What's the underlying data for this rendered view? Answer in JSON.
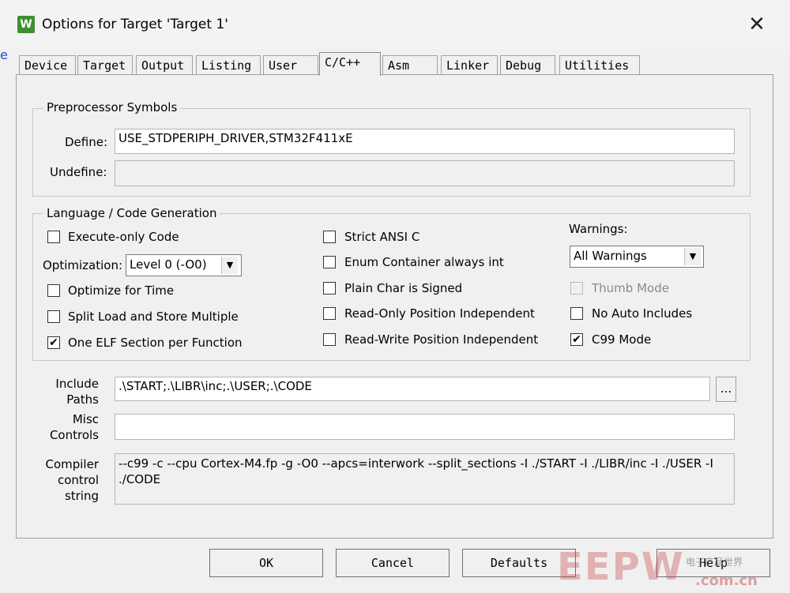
{
  "window": {
    "title": "Options for Target 'Target 1'",
    "close": "✕",
    "left_artifact": "e"
  },
  "tabs": [
    {
      "label": "Device"
    },
    {
      "label": "Target"
    },
    {
      "label": "Output"
    },
    {
      "label": "Listing"
    },
    {
      "label": "User"
    },
    {
      "label": "C/C++"
    },
    {
      "label": "Asm"
    },
    {
      "label": "Linker"
    },
    {
      "label": "Debug"
    },
    {
      "label": "Utilities"
    }
  ],
  "active_tab": "C/C++",
  "preprocessor": {
    "group_label": "Preprocessor Symbols",
    "define_label": "Define:",
    "define_value": "USE_STDPERIPH_DRIVER,STM32F411xE",
    "undefine_label": "Undefine:",
    "undefine_value": ""
  },
  "codegen": {
    "group_label": "Language / Code Generation",
    "execute_only": {
      "label": "Execute-only Code",
      "checked": false
    },
    "optimization_label": "Optimization:",
    "optimization_value": "Level 0 (-O0)",
    "optimize_time": {
      "label": "Optimize for Time",
      "checked": false
    },
    "split_load": {
      "label": "Split Load and Store Multiple",
      "checked": false
    },
    "one_elf": {
      "label": "One ELF Section per Function",
      "checked": true
    },
    "strict_ansi": {
      "label": "Strict ANSI C",
      "checked": false
    },
    "enum_container": {
      "label": "Enum Container always int",
      "checked": false
    },
    "plain_char": {
      "label": "Plain Char is Signed",
      "checked": false
    },
    "ro_pos": {
      "label": "Read-Only Position Independent",
      "checked": false
    },
    "rw_pos": {
      "label": "Read-Write Position Independent",
      "checked": false
    },
    "warnings_label": "Warnings:",
    "warnings_value": "All Warnings",
    "thumb_mode": {
      "label": "Thumb Mode",
      "checked": false
    },
    "no_auto_includes": {
      "label": "No Auto Includes",
      "checked": false
    },
    "c99_mode": {
      "label": "C99 Mode",
      "checked": true
    }
  },
  "include": {
    "label_line1": "Include",
    "label_line2": "Paths",
    "value": ".\\START;.\\LIBR\\inc;.\\USER;.\\CODE",
    "browse": "..."
  },
  "misc": {
    "label_line1": "Misc",
    "label_line2": "Controls",
    "value": ""
  },
  "compiler": {
    "label_line1": "Compiler",
    "label_line2": "control",
    "label_line3": "string",
    "value": "--c99 -c --cpu Cortex-M4.fp -g -O0 --apcs=interwork --split_sections -I ./START -I ./LIBR/inc -I ./USER -I ./CODE"
  },
  "buttons": {
    "ok": "OK",
    "cancel": "Cancel",
    "defaults": "Defaults",
    "help": "Help"
  },
  "watermark": {
    "text": "EEPW",
    "sub": ".com.cn",
    "small": "电子产品世界"
  }
}
